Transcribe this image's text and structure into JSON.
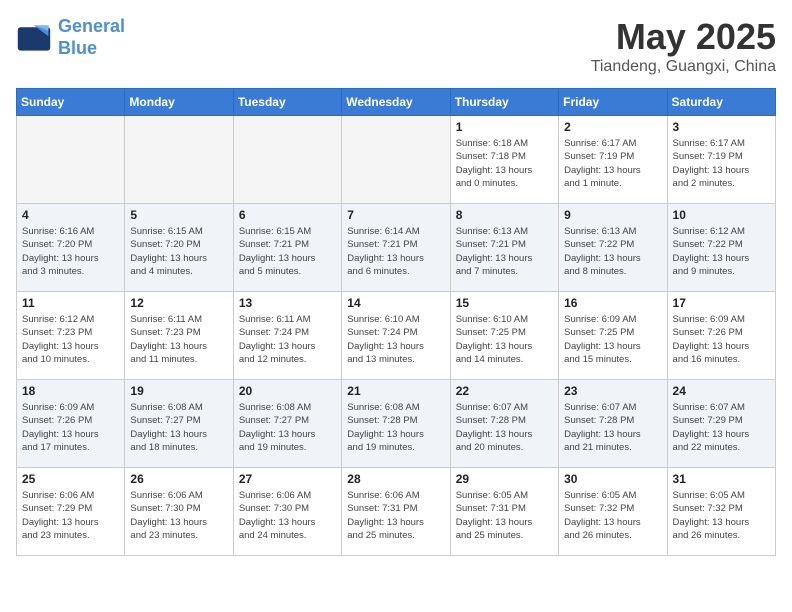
{
  "header": {
    "logo_line1": "General",
    "logo_line2": "Blue",
    "title": "May 2025",
    "subtitle": "Tiandeng, Guangxi, China"
  },
  "weekdays": [
    "Sunday",
    "Monday",
    "Tuesday",
    "Wednesday",
    "Thursday",
    "Friday",
    "Saturday"
  ],
  "weeks": [
    [
      {
        "day": "",
        "empty": true
      },
      {
        "day": "",
        "empty": true
      },
      {
        "day": "",
        "empty": true
      },
      {
        "day": "",
        "empty": true
      },
      {
        "day": "1",
        "info": "Sunrise: 6:18 AM\nSunset: 7:18 PM\nDaylight: 13 hours\nand 0 minutes."
      },
      {
        "day": "2",
        "info": "Sunrise: 6:17 AM\nSunset: 7:19 PM\nDaylight: 13 hours\nand 1 minute."
      },
      {
        "day": "3",
        "info": "Sunrise: 6:17 AM\nSunset: 7:19 PM\nDaylight: 13 hours\nand 2 minutes."
      }
    ],
    [
      {
        "day": "4",
        "info": "Sunrise: 6:16 AM\nSunset: 7:20 PM\nDaylight: 13 hours\nand 3 minutes."
      },
      {
        "day": "5",
        "info": "Sunrise: 6:15 AM\nSunset: 7:20 PM\nDaylight: 13 hours\nand 4 minutes."
      },
      {
        "day": "6",
        "info": "Sunrise: 6:15 AM\nSunset: 7:21 PM\nDaylight: 13 hours\nand 5 minutes."
      },
      {
        "day": "7",
        "info": "Sunrise: 6:14 AM\nSunset: 7:21 PM\nDaylight: 13 hours\nand 6 minutes."
      },
      {
        "day": "8",
        "info": "Sunrise: 6:13 AM\nSunset: 7:21 PM\nDaylight: 13 hours\nand 7 minutes."
      },
      {
        "day": "9",
        "info": "Sunrise: 6:13 AM\nSunset: 7:22 PM\nDaylight: 13 hours\nand 8 minutes."
      },
      {
        "day": "10",
        "info": "Sunrise: 6:12 AM\nSunset: 7:22 PM\nDaylight: 13 hours\nand 9 minutes."
      }
    ],
    [
      {
        "day": "11",
        "info": "Sunrise: 6:12 AM\nSunset: 7:23 PM\nDaylight: 13 hours\nand 10 minutes."
      },
      {
        "day": "12",
        "info": "Sunrise: 6:11 AM\nSunset: 7:23 PM\nDaylight: 13 hours\nand 11 minutes."
      },
      {
        "day": "13",
        "info": "Sunrise: 6:11 AM\nSunset: 7:24 PM\nDaylight: 13 hours\nand 12 minutes."
      },
      {
        "day": "14",
        "info": "Sunrise: 6:10 AM\nSunset: 7:24 PM\nDaylight: 13 hours\nand 13 minutes."
      },
      {
        "day": "15",
        "info": "Sunrise: 6:10 AM\nSunset: 7:25 PM\nDaylight: 13 hours\nand 14 minutes."
      },
      {
        "day": "16",
        "info": "Sunrise: 6:09 AM\nSunset: 7:25 PM\nDaylight: 13 hours\nand 15 minutes."
      },
      {
        "day": "17",
        "info": "Sunrise: 6:09 AM\nSunset: 7:26 PM\nDaylight: 13 hours\nand 16 minutes."
      }
    ],
    [
      {
        "day": "18",
        "info": "Sunrise: 6:09 AM\nSunset: 7:26 PM\nDaylight: 13 hours\nand 17 minutes."
      },
      {
        "day": "19",
        "info": "Sunrise: 6:08 AM\nSunset: 7:27 PM\nDaylight: 13 hours\nand 18 minutes."
      },
      {
        "day": "20",
        "info": "Sunrise: 6:08 AM\nSunset: 7:27 PM\nDaylight: 13 hours\nand 19 minutes."
      },
      {
        "day": "21",
        "info": "Sunrise: 6:08 AM\nSunset: 7:28 PM\nDaylight: 13 hours\nand 19 minutes."
      },
      {
        "day": "22",
        "info": "Sunrise: 6:07 AM\nSunset: 7:28 PM\nDaylight: 13 hours\nand 20 minutes."
      },
      {
        "day": "23",
        "info": "Sunrise: 6:07 AM\nSunset: 7:28 PM\nDaylight: 13 hours\nand 21 minutes."
      },
      {
        "day": "24",
        "info": "Sunrise: 6:07 AM\nSunset: 7:29 PM\nDaylight: 13 hours\nand 22 minutes."
      }
    ],
    [
      {
        "day": "25",
        "info": "Sunrise: 6:06 AM\nSunset: 7:29 PM\nDaylight: 13 hours\nand 23 minutes."
      },
      {
        "day": "26",
        "info": "Sunrise: 6:06 AM\nSunset: 7:30 PM\nDaylight: 13 hours\nand 23 minutes."
      },
      {
        "day": "27",
        "info": "Sunrise: 6:06 AM\nSunset: 7:30 PM\nDaylight: 13 hours\nand 24 minutes."
      },
      {
        "day": "28",
        "info": "Sunrise: 6:06 AM\nSunset: 7:31 PM\nDaylight: 13 hours\nand 25 minutes."
      },
      {
        "day": "29",
        "info": "Sunrise: 6:05 AM\nSunset: 7:31 PM\nDaylight: 13 hours\nand 25 minutes."
      },
      {
        "day": "30",
        "info": "Sunrise: 6:05 AM\nSunset: 7:32 PM\nDaylight: 13 hours\nand 26 minutes."
      },
      {
        "day": "31",
        "info": "Sunrise: 6:05 AM\nSunset: 7:32 PM\nDaylight: 13 hours\nand 26 minutes."
      }
    ]
  ]
}
